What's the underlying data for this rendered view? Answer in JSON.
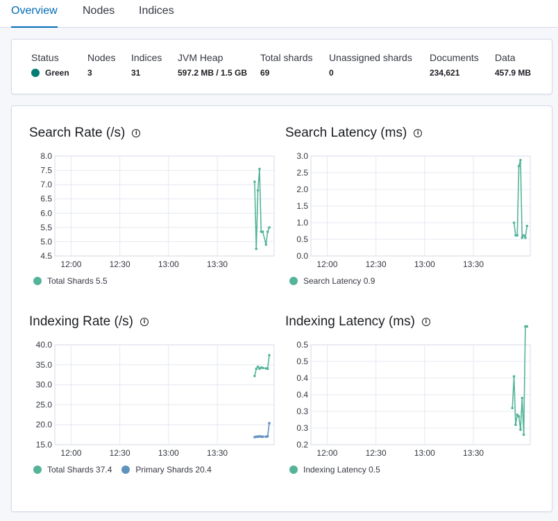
{
  "tabs": [
    {
      "label": "Overview",
      "active": true
    },
    {
      "label": "Nodes",
      "active": false
    },
    {
      "label": "Indices",
      "active": false
    }
  ],
  "summary": {
    "status": {
      "label": "Status",
      "value": "Green",
      "color": "#017d73"
    },
    "nodes": {
      "label": "Nodes",
      "value": "3"
    },
    "indices": {
      "label": "Indices",
      "value": "31"
    },
    "jvm_heap": {
      "label": "JVM Heap",
      "value": "597.2 MB / 1.5 GB"
    },
    "total_shards": {
      "label": "Total shards",
      "value": "69"
    },
    "unassigned_shards": {
      "label": "Unassigned shards",
      "value": "0"
    },
    "documents": {
      "label": "Documents",
      "value": "234,621"
    },
    "data": {
      "label": "Data",
      "value": "457.9 MB"
    }
  },
  "icons": {
    "info": "info-circle-icon"
  },
  "chart_data": [
    {
      "type": "line",
      "title": "Search Rate (/s)",
      "x_ticks": [
        "12:00",
        "12:30",
        "13:00",
        "13:30"
      ],
      "x_range": [
        "11:50",
        "14:05"
      ],
      "y_ticks": [
        "4.5",
        "5.0",
        "5.5",
        "6.0",
        "6.5",
        "7.0",
        "7.5",
        "8.0"
      ],
      "ylim": [
        4.5,
        8.0
      ],
      "grid": true,
      "series": [
        {
          "name": "Total Shards",
          "legend_value": "5.5",
          "color": "#54b399",
          "x": [
            "13:53",
            "13:54",
            "13:55",
            "13:56",
            "13:57",
            "13:58",
            "14:00",
            "14:01",
            "14:02"
          ],
          "y": [
            7.1,
            4.75,
            6.8,
            7.55,
            5.35,
            5.35,
            4.9,
            5.35,
            5.5
          ]
        }
      ]
    },
    {
      "type": "line",
      "title": "Search Latency (ms)",
      "x_ticks": [
        "12:00",
        "12:30",
        "13:00",
        "13:30"
      ],
      "x_range": [
        "11:50",
        "14:05"
      ],
      "y_ticks": [
        "0.0",
        "0.5",
        "1.0",
        "1.5",
        "2.0",
        "2.5",
        "3.0"
      ],
      "ylim": [
        0.0,
        3.0
      ],
      "grid": true,
      "series": [
        {
          "name": "Search Latency",
          "legend_value": "0.9",
          "color": "#54b399",
          "x": [
            "13:55",
            "13:56",
            "13:57",
            "13:58",
            "13:59",
            "14:00",
            "14:01",
            "14:02",
            "14:03"
          ],
          "y": [
            1.0,
            0.62,
            0.62,
            2.7,
            2.88,
            0.55,
            0.62,
            0.55,
            0.9
          ]
        }
      ]
    },
    {
      "type": "line",
      "title": "Indexing Rate (/s)",
      "x_ticks": [
        "12:00",
        "12:30",
        "13:00",
        "13:30"
      ],
      "x_range": [
        "11:50",
        "14:05"
      ],
      "y_ticks": [
        "15.0",
        "20.0",
        "25.0",
        "30.0",
        "35.0",
        "40.0"
      ],
      "ylim": [
        15.0,
        40.0
      ],
      "grid": true,
      "series": [
        {
          "name": "Total Shards",
          "legend_value": "37.4",
          "color": "#54b399",
          "x": [
            "13:53",
            "13:54",
            "13:55",
            "13:56",
            "13:57",
            "13:58",
            "14:00",
            "14:01",
            "14:02"
          ],
          "y": [
            32.2,
            34.0,
            34.5,
            34.0,
            34.3,
            34.2,
            34.1,
            34.0,
            37.4
          ]
        },
        {
          "name": "Primary Shards",
          "legend_value": "20.4",
          "color": "#6092c0",
          "x": [
            "13:53",
            "13:54",
            "13:55",
            "13:56",
            "13:57",
            "13:58",
            "14:00",
            "14:01",
            "14:02"
          ],
          "y": [
            16.9,
            17.0,
            17.0,
            17.1,
            17.0,
            17.0,
            17.0,
            17.1,
            20.4
          ]
        }
      ]
    },
    {
      "type": "line",
      "title": "Indexing Latency (ms)",
      "x_ticks": [
        "12:00",
        "12:30",
        "13:00",
        "13:30"
      ],
      "x_range": [
        "11:50",
        "14:05"
      ],
      "y_ticks": [
        "0.2",
        "0.3",
        "0.3",
        "0.4",
        "0.4",
        "0.5",
        "0.5"
      ],
      "ylim": [
        0.2,
        0.5
      ],
      "grid": true,
      "series": [
        {
          "name": "Indexing Latency",
          "legend_value": "0.5",
          "color": "#54b399",
          "x": [
            "13:54",
            "13:55",
            "13:56",
            "13:57",
            "13:58",
            "13:59",
            "14:00",
            "14:01",
            "14:02",
            "14:03"
          ],
          "y": [
            0.31,
            0.405,
            0.26,
            0.29,
            0.285,
            0.245,
            0.34,
            0.23,
            0.555,
            0.555
          ]
        }
      ]
    }
  ]
}
